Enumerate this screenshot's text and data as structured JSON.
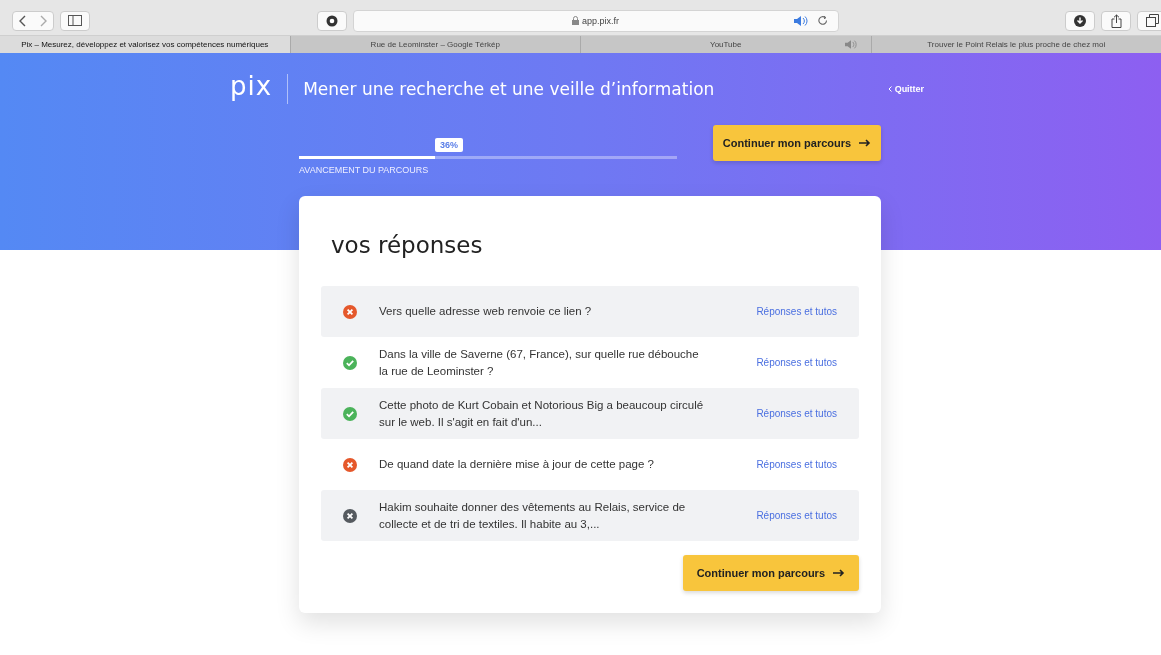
{
  "browser": {
    "url": "app.pix.fr",
    "audio_playing": true,
    "tabs": [
      {
        "title": "Pix – Mesurez, développez et valorisez vos compétences numériques",
        "selected": true,
        "audio": false
      },
      {
        "title": "Rue de Leominster – Google Térkép",
        "selected": false,
        "audio": false
      },
      {
        "title": "YouTube",
        "selected": false,
        "audio": true
      },
      {
        "title": "Trouver le Point Relais le plus proche de chez moi",
        "selected": false,
        "audio": false
      }
    ]
  },
  "header": {
    "logo": "pix",
    "title": "Mener une recherche et une veille d’information",
    "quit": "Quitter",
    "progress": {
      "level": 0.36,
      "badge": "36%",
      "label": "AVANCEMENT DU PARCOURS"
    },
    "continue_button": "Continuer mon parcours"
  },
  "answers": {
    "title": "vos réponses",
    "rows": [
      {
        "kind": "wrong",
        "question": "Vers quelle adresse web renvoie ce lien ?",
        "link": "Réponses et tutos"
      },
      {
        "kind": "correct",
        "question": "Dans la ville de Saverne (67, France), sur quelle rue débouche la rue de Leominster ?",
        "link": "Réponses et tutos"
      },
      {
        "kind": "correct",
        "question": "Cette photo de Kurt Cobain et Notorious Big a beaucoup circulé sur le web. Il s'agit en fait d'un...",
        "link": "Réponses et tutos"
      },
      {
        "kind": "wrong",
        "question": "De quand date la dernière mise à jour de cette page ?",
        "link": "Réponses et tutos"
      },
      {
        "kind": "skipped",
        "question": "Hakim souhaite donner des vêtements au Relais, service de collecte et de tri de textiles. Il habite au 3,...",
        "link": "Réponses et tutos"
      }
    ],
    "continue_button": "Continuer mon parcours"
  }
}
